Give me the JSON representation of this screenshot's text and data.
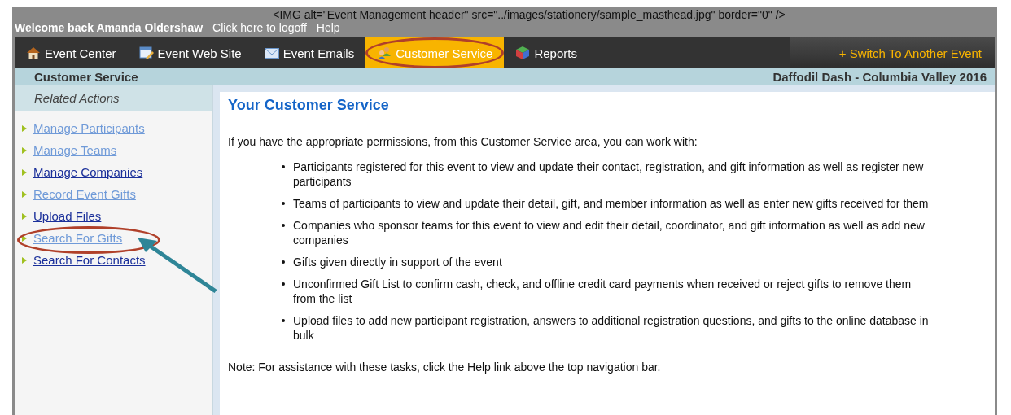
{
  "masthead_code": "<IMG alt=\"Event Management header\" src=\"../images/stationery/sample_masthead.jpg\" border=\"0\" />",
  "welcome": {
    "text": "Welcome back Amanda Oldershaw",
    "links": [
      "Click here to logoff",
      "Help"
    ]
  },
  "nav": {
    "tabs": [
      {
        "label": "Event Center",
        "selected": false,
        "highlighted": false
      },
      {
        "label": "Event Web Site",
        "selected": false,
        "highlighted": false
      },
      {
        "label": "Event Emails",
        "selected": false,
        "highlighted": false
      },
      {
        "label": "Customer Service",
        "selected": true,
        "highlighted": true
      },
      {
        "label": "Reports",
        "selected": false,
        "highlighted": false
      }
    ],
    "switch_link": "+ Switch To Another Event"
  },
  "subheader": {
    "section": "Customer Service",
    "event": "Daffodil Dash - Columbia Valley 2016"
  },
  "sidebar": {
    "title": "Related Actions",
    "items": [
      {
        "label": "Manage Participants",
        "visited": true,
        "highlighted": false,
        "arrow": false
      },
      {
        "label": "Manage Teams",
        "visited": true,
        "highlighted": false,
        "arrow": false
      },
      {
        "label": "Manage Companies",
        "visited": false,
        "highlighted": false,
        "arrow": false
      },
      {
        "label": "Record Event Gifts",
        "visited": true,
        "highlighted": false,
        "arrow": false
      },
      {
        "label": "Upload Files",
        "visited": false,
        "highlighted": false,
        "arrow": false
      },
      {
        "label": "Search For Gifts",
        "visited": true,
        "highlighted": true,
        "arrow": true
      },
      {
        "label": "Search For Contacts",
        "visited": false,
        "highlighted": false,
        "arrow": false
      }
    ]
  },
  "content": {
    "title": "Your Customer Service",
    "intro": "If you have the appropriate permissions, from this Customer Service area, you can work with:",
    "bullets": [
      "Participants registered for this event to view and update their contact, registration, and gift information as well as register new participants",
      "Teams of participants to view and update their detail, gift, and member information as well as enter new gifts received for them",
      "Companies who sponsor teams for this event to view and edit their detail, coordinator, and gift information as well as add new companies",
      "Gifts given directly in support of the event",
      "Unconfirmed Gift List to confirm cash, check, and offline credit card payments when received or reject gifts to remove them from the list",
      "Upload files to add new participant registration, answers to additional registration questions, and gifts to the online database in bulk"
    ],
    "note": "Note: For assistance with these tasks, click the Help link above the top navigation bar."
  }
}
